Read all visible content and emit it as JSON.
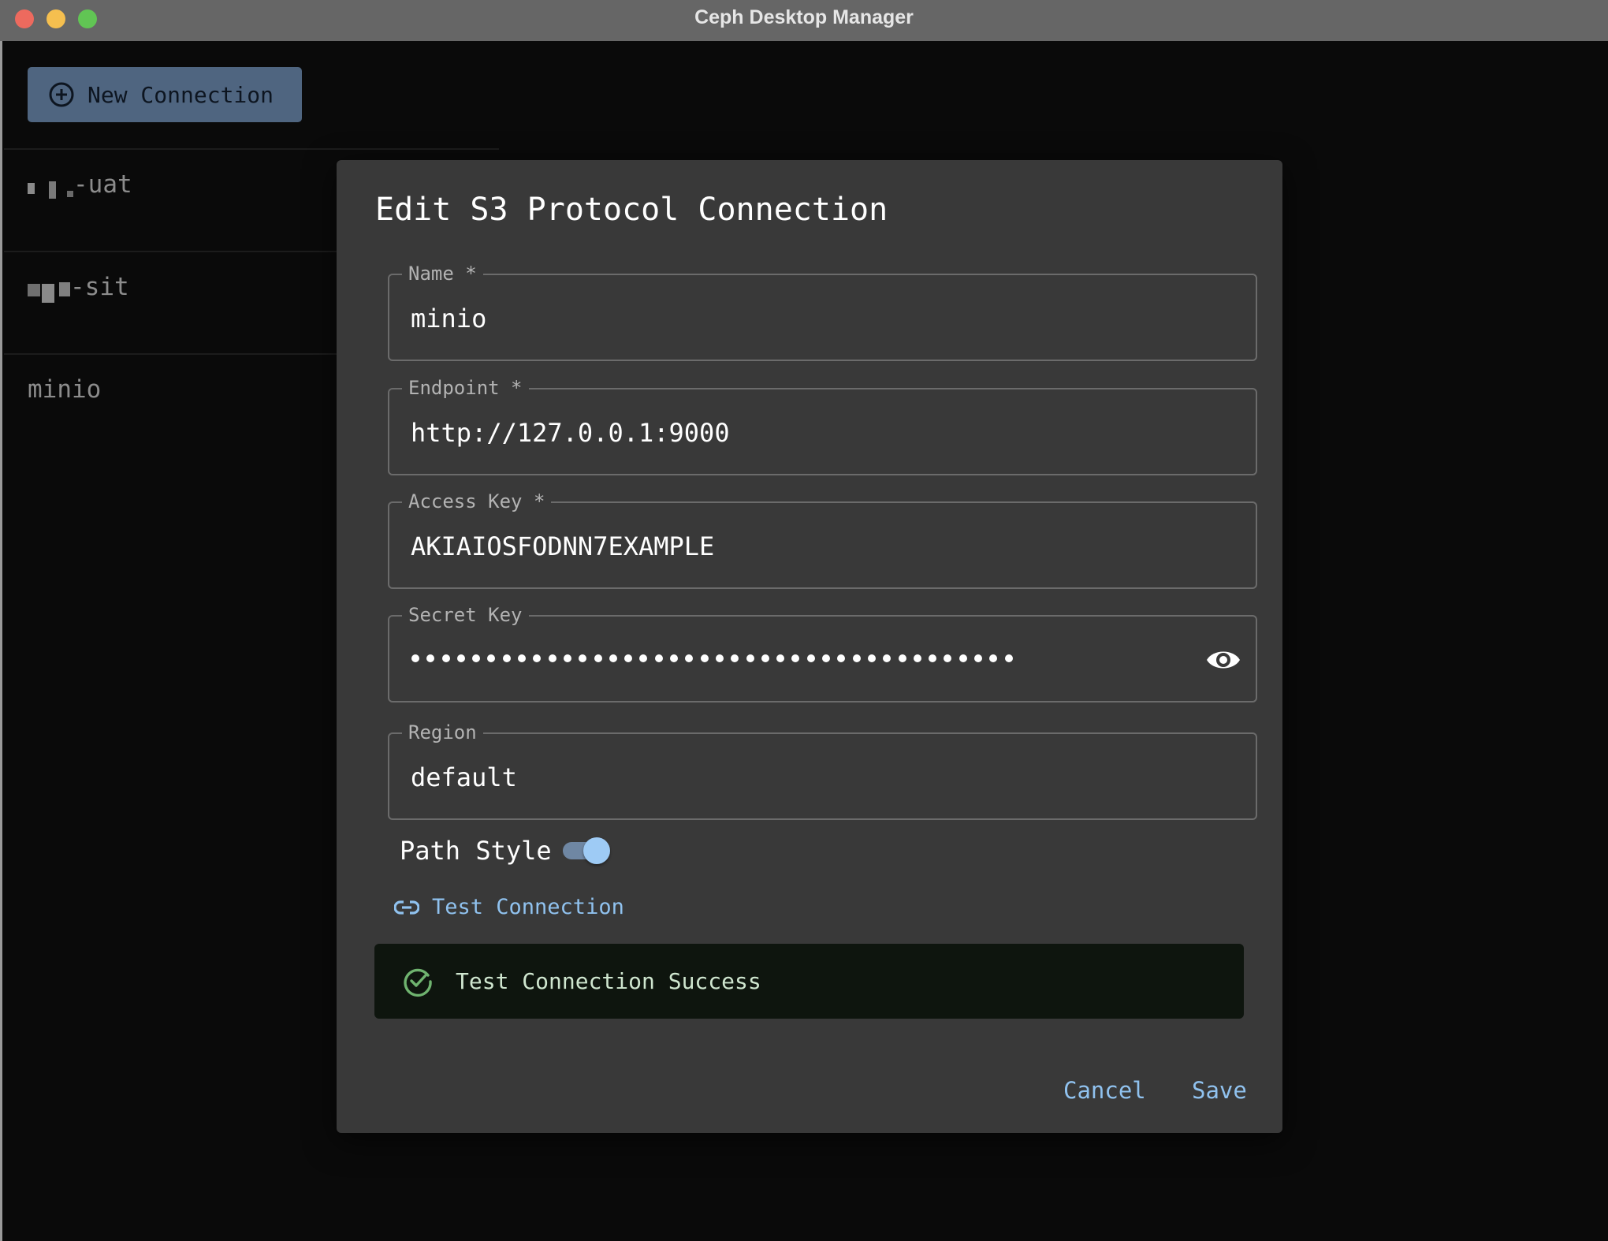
{
  "window": {
    "title": "Ceph Desktop Manager"
  },
  "sidebar": {
    "new_connection_label": "New Connection",
    "connections": [
      {
        "label": "-uat",
        "redacted_prefix": true
      },
      {
        "label": "-sit",
        "redacted_prefix": true
      },
      {
        "label": "minio",
        "redacted_prefix": false
      }
    ]
  },
  "dialog": {
    "title": "Edit S3 Protocol Connection",
    "fields": {
      "name": {
        "label": "Name *",
        "value": "minio"
      },
      "endpoint": {
        "label": "Endpoint *",
        "value": "http://127.0.0.1:9000"
      },
      "access_key": {
        "label": "Access Key *",
        "value": "AKIAIOSFODNN7EXAMPLE"
      },
      "secret_key": {
        "label": "Secret Key",
        "masked_length": 40,
        "visibility_icon": "eye-icon"
      },
      "region": {
        "label": "Region",
        "value": "default"
      }
    },
    "path_style": {
      "label": "Path Style",
      "enabled": true
    },
    "test_connection_label": "Test Connection",
    "alert": {
      "type": "success",
      "message": "Test Connection Success"
    },
    "actions": {
      "cancel_label": "Cancel",
      "save_label": "Save"
    }
  },
  "colors": {
    "accent": "#90c2ef",
    "toggle_thumb": "#9ecbf5",
    "success": "#6fb36f",
    "button_bg": "#4f6580",
    "dialog_bg": "#393939"
  }
}
